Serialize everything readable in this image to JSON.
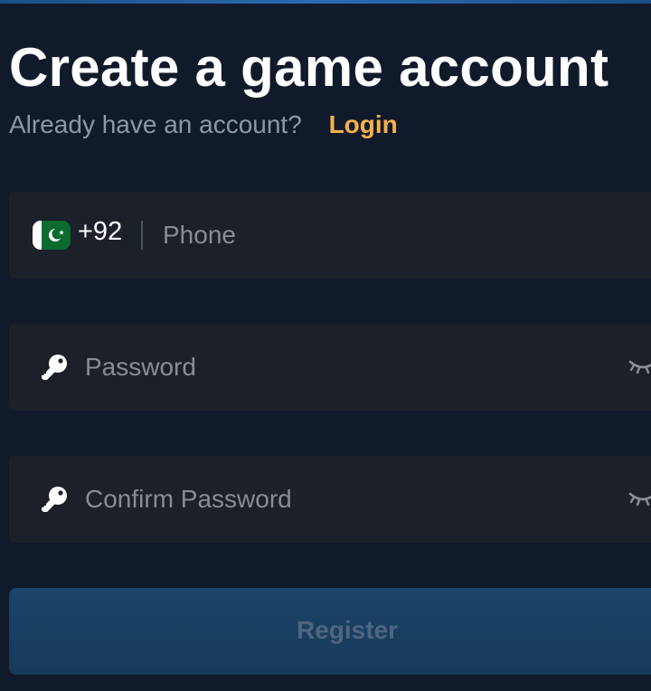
{
  "header": {
    "title": "Create a game account",
    "subtitle": "Already have an account?",
    "login_link": "Login"
  },
  "form": {
    "phone": {
      "country_code": "+92",
      "country_flag": "pakistan-flag-icon",
      "placeholder": "Phone",
      "value": ""
    },
    "password": {
      "placeholder": "Password",
      "value": "",
      "icon": "key-icon",
      "toggle_icon": "eye-closed-icon"
    },
    "confirm_password": {
      "placeholder": "Confirm Password",
      "value": "",
      "icon": "key-icon",
      "toggle_icon": "eye-closed-icon"
    },
    "register_label": "Register"
  },
  "colors": {
    "background": "#111a2b",
    "field_background": "#1c2029",
    "accent": "#f6b14b",
    "button_background": "#1b4466",
    "button_text": "#4f6580",
    "top_border": "#2a6bb3"
  }
}
